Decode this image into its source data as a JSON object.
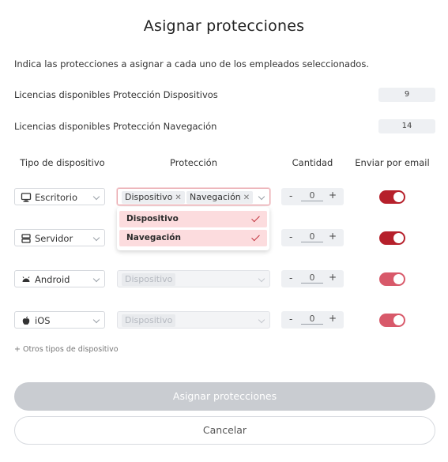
{
  "dialog": {
    "title": "Asignar protecciones",
    "intro": "Indica las protecciones a asignar a cada uno de los empleados seleccionados."
  },
  "licenses": [
    {
      "label": "Licencias disponibles Protección Dispositivos",
      "value": "9"
    },
    {
      "label": "Licencias disponibles Protección Navegación",
      "value": "14"
    }
  ],
  "columns": {
    "device_type": "Tipo de dispositivo",
    "protection": "Protección",
    "quantity": "Cantidad",
    "email": "Enviar por email"
  },
  "rows": [
    {
      "device": "Escritorio",
      "icon": "desktop-icon",
      "tags": [
        "Dispositivo",
        "Navegación"
      ],
      "disabled": false,
      "qty_minus": "-",
      "qty": "0",
      "qty_plus": "+",
      "email_enabled": true
    },
    {
      "device": "Servidor",
      "icon": "server-icon",
      "tags": [],
      "disabled": false,
      "qty_minus": "-",
      "qty": "0",
      "qty_plus": "+",
      "email_enabled": true
    },
    {
      "device": "Android",
      "icon": "android-icon",
      "tags": [
        "Dispositivo"
      ],
      "disabled": true,
      "qty_minus": "-",
      "qty": "0",
      "qty_plus": "+",
      "email_enabled": true
    },
    {
      "device": "iOS",
      "icon": "apple-icon",
      "tags": [
        "Dispositivo"
      ],
      "disabled": true,
      "qty_minus": "-",
      "qty": "0",
      "qty_plus": "+",
      "email_enabled": true
    }
  ],
  "dropdown": {
    "options": [
      {
        "label": "Dispositivo",
        "selected": true
      },
      {
        "label": "Navegación",
        "selected": true
      }
    ]
  },
  "other_types": "+ Otros tipos de dispositivo",
  "buttons": {
    "assign": "Asignar protecciones",
    "cancel": "Cancelar"
  },
  "colors": {
    "accent": "#b6202b",
    "accent_light": "#d8596a",
    "selected_option_bg": "#fcdcde",
    "disabled_button": "#c9ccd1"
  }
}
